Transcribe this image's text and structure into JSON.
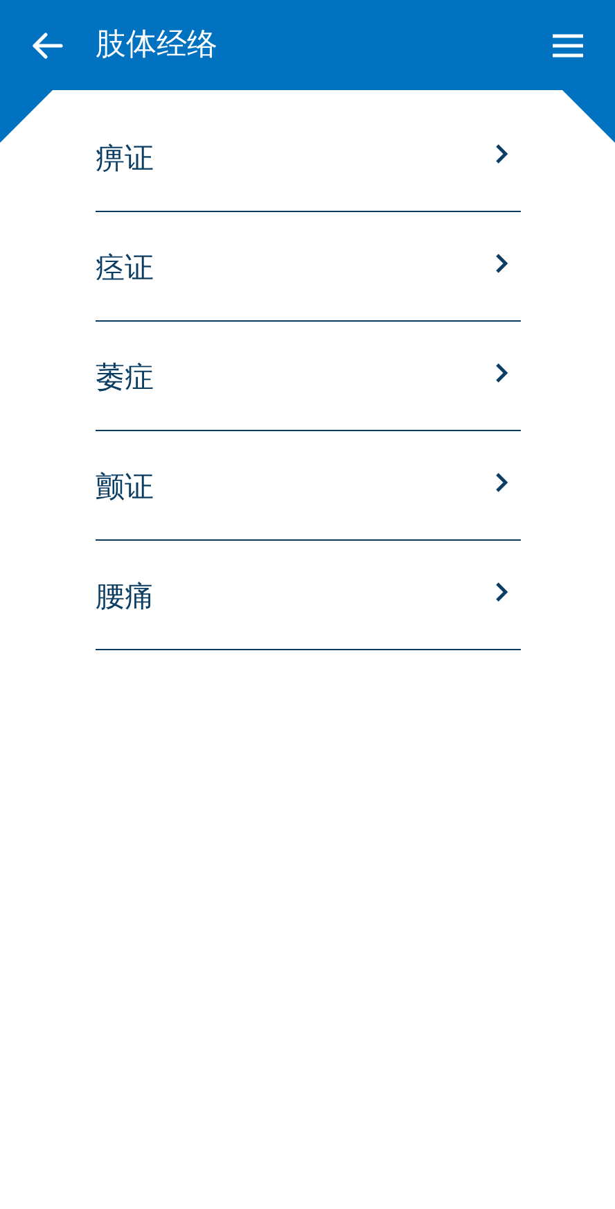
{
  "header": {
    "title": "肢体经络"
  },
  "items": [
    {
      "label": "痹证"
    },
    {
      "label": "痉证"
    },
    {
      "label": "萎症"
    },
    {
      "label": "颤证"
    },
    {
      "label": "腰痛"
    }
  ]
}
